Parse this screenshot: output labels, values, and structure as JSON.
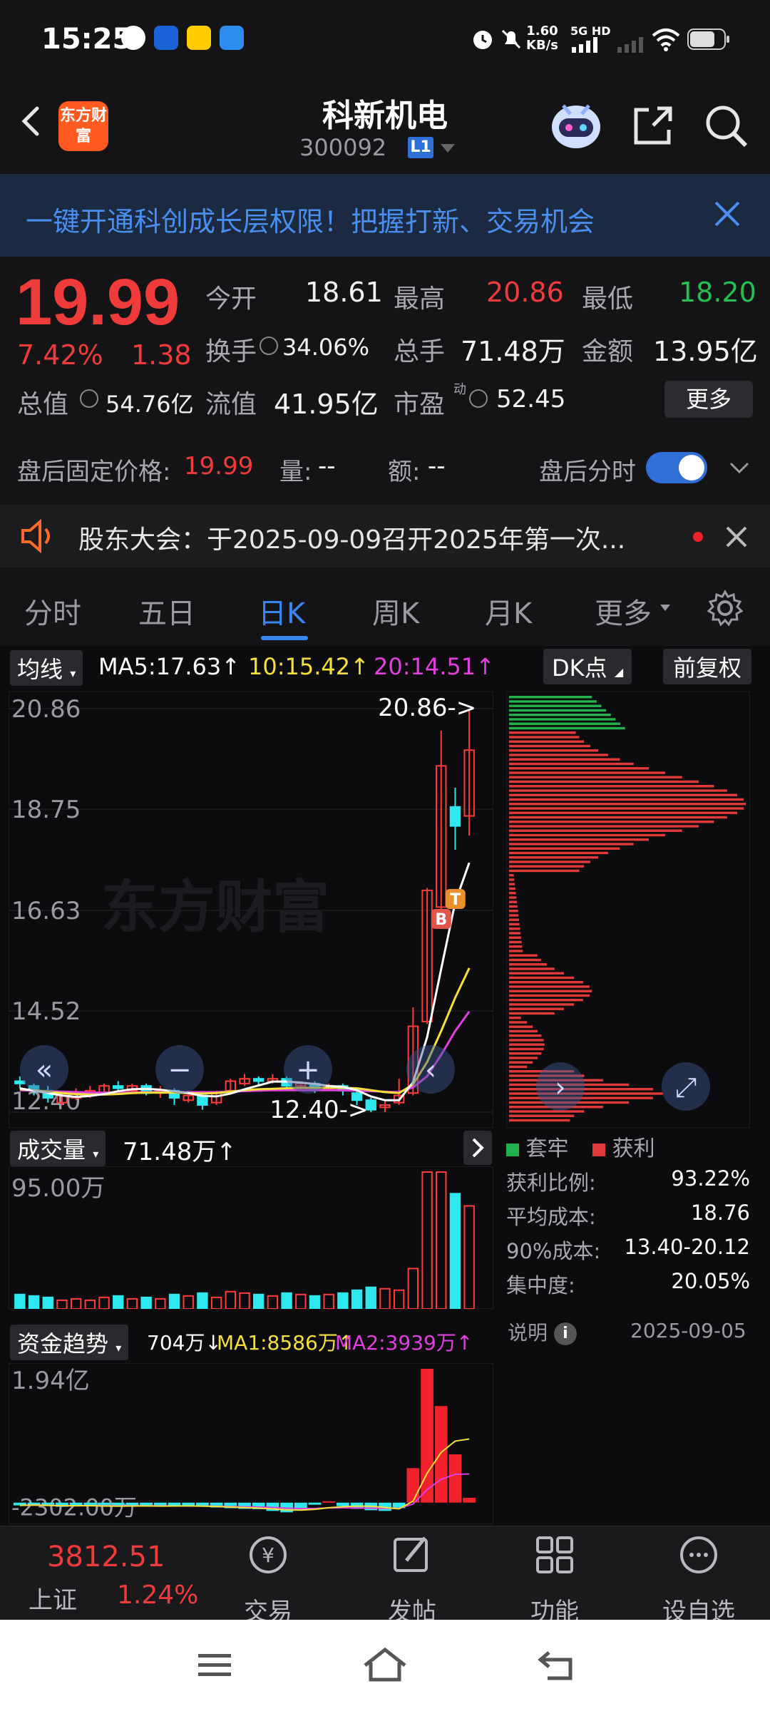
{
  "status": {
    "time": "15:25",
    "speed_value": "1.60",
    "speed_unit": "KB/s",
    "network": "5G HD"
  },
  "header": {
    "title": "科新机电",
    "code": "300092",
    "level": "L1",
    "logo_text": "东方财富"
  },
  "banner": {
    "text": "一键开通科创成长层权限！把握打新、交易机会"
  },
  "quote": {
    "price": "19.99",
    "change_pct": "7.42%",
    "change": "1.38",
    "open_label": "今开",
    "open": "18.61",
    "high_label": "最高",
    "high": "20.86",
    "low_label": "最低",
    "low": "18.20",
    "turnover_label": "换手",
    "turnover": "34.06%",
    "volume_label": "总手",
    "volume": "71.48万",
    "amount_label": "金额",
    "amount": "13.95亿",
    "mktcap_label": "总值",
    "mktcap": "54.76亿",
    "float_label": "流值",
    "float": "41.95亿",
    "pe_label": "市盈",
    "pe_sup": "动",
    "pe": "52.45",
    "more_label": "更多"
  },
  "after_hours": {
    "price_label": "盘后固定价格:",
    "price": "19.99",
    "vol_label": "量:",
    "vol": "--",
    "amt_label": "额:",
    "amt": "--",
    "switch_label": "盘后分时"
  },
  "notice": {
    "text": "股东大会：于2025-09-09召开2025年第一次..."
  },
  "tabs": [
    "分时",
    "五日",
    "日K",
    "周K",
    "月K",
    "更多"
  ],
  "chart_header": {
    "ma_pill": "均线",
    "ma5": "MA5:17.63",
    "ma10": "10:15.42",
    "ma20": "20:14.51",
    "up": "↑",
    "dk_pill": "DK点",
    "adj_pill": "前复权"
  },
  "chart_data": [
    {
      "type": "candlestick",
      "y_ticks": [
        "20.86",
        "18.75",
        "16.63",
        "14.52",
        "12.40"
      ],
      "ylim": [
        12.4,
        20.86
      ],
      "annotations": [
        "20.86->",
        "12.40->"
      ],
      "markers": [
        "B",
        "T"
      ],
      "watermark": "东方财富",
      "candles": [
        [
          13.05,
          13.0,
          13.15,
          12.9
        ],
        [
          12.95,
          12.85,
          13.0,
          12.75
        ],
        [
          12.85,
          12.7,
          12.95,
          12.6
        ],
        [
          12.6,
          12.75,
          12.8,
          12.55
        ],
        [
          12.7,
          12.8,
          12.9,
          12.65
        ],
        [
          12.75,
          12.85,
          12.95,
          12.7
        ],
        [
          12.8,
          12.95,
          13.0,
          12.75
        ],
        [
          12.95,
          12.9,
          13.05,
          12.8
        ],
        [
          12.85,
          12.95,
          13.0,
          12.8
        ],
        [
          12.95,
          12.8,
          13.0,
          12.75
        ],
        [
          12.8,
          12.85,
          12.95,
          12.7
        ],
        [
          12.85,
          12.7,
          12.9,
          12.55
        ],
        [
          12.65,
          12.75,
          12.85,
          12.6
        ],
        [
          12.75,
          12.55,
          12.8,
          12.45
        ],
        [
          12.6,
          12.8,
          12.85,
          12.55
        ],
        [
          12.85,
          13.05,
          13.1,
          12.8
        ],
        [
          13.0,
          13.1,
          13.2,
          12.95
        ],
        [
          13.1,
          13.05,
          13.15,
          12.95
        ],
        [
          13.05,
          13.1,
          13.2,
          13.0
        ],
        [
          13.1,
          12.95,
          13.15,
          12.9
        ],
        [
          12.95,
          13.0,
          13.05,
          12.85
        ],
        [
          13.0,
          12.9,
          13.05,
          12.8
        ],
        [
          12.9,
          12.95,
          13.0,
          12.85
        ],
        [
          12.95,
          12.85,
          13.0,
          12.75
        ],
        [
          12.8,
          12.65,
          12.85,
          12.55
        ],
        [
          12.65,
          12.45,
          12.7,
          12.4
        ],
        [
          12.5,
          12.55,
          12.65,
          12.4
        ],
        [
          12.6,
          12.75,
          13.1,
          12.55
        ],
        [
          12.8,
          14.2,
          14.6,
          12.75
        ],
        [
          14.3,
          17.05,
          17.1,
          14.25
        ],
        [
          16.7,
          19.66,
          20.4,
          16.5
        ],
        [
          18.8,
          18.4,
          19.2,
          17.9
        ],
        [
          18.61,
          19.99,
          20.86,
          18.2
        ]
      ],
      "ma5": [
        12.9,
        12.85,
        12.8,
        12.75,
        12.72,
        12.74,
        12.78,
        12.84,
        12.88,
        12.89,
        12.87,
        12.84,
        12.8,
        12.74,
        12.73,
        12.79,
        12.88,
        12.96,
        13.04,
        13.04,
        13.02,
        12.99,
        12.95,
        12.93,
        12.86,
        12.73,
        12.65,
        12.65,
        13.03,
        13.97,
        15.4,
        16.8,
        17.63
      ],
      "ma10": [
        12.88,
        12.86,
        12.83,
        12.8,
        12.78,
        12.77,
        12.77,
        12.78,
        12.8,
        12.81,
        12.81,
        12.81,
        12.8,
        12.79,
        12.8,
        12.83,
        12.86,
        12.88,
        12.89,
        12.9,
        12.91,
        12.91,
        12.91,
        12.91,
        12.9,
        12.86,
        12.82,
        12.8,
        12.98,
        13.45,
        14.1,
        14.8,
        15.42
      ],
      "ma20": [
        12.86,
        12.85,
        12.84,
        12.83,
        12.82,
        12.81,
        12.81,
        12.81,
        12.81,
        12.82,
        12.82,
        12.82,
        12.82,
        12.82,
        12.82,
        12.83,
        12.84,
        12.85,
        12.86,
        12.86,
        12.86,
        12.86,
        12.86,
        12.86,
        12.85,
        12.84,
        12.83,
        12.82,
        12.92,
        13.15,
        13.6,
        14.1,
        14.51
      ]
    },
    {
      "type": "bar",
      "title": "成交量",
      "value_label": "71.48万",
      "y_max_label": "95.00万",
      "values": [
        10,
        9,
        8,
        6,
        7,
        6,
        8,
        9,
        7,
        8,
        7,
        10,
        9,
        11,
        8,
        12,
        11,
        10,
        9,
        11,
        10,
        9,
        10,
        11,
        13,
        15,
        14,
        13,
        28,
        95,
        95,
        80,
        71.48
      ]
    },
    {
      "type": "bar",
      "title": "资金趋势",
      "value_label": "704万",
      "ma1": "MA1:8586万",
      "ma2": "MA2:3939万",
      "y_max_label": "1.94亿",
      "y_min_label": "-2302.00万",
      "values": [
        -400,
        -300,
        -500,
        -600,
        -450,
        -350,
        -550,
        -600,
        -500,
        -400,
        -450,
        -500,
        -550,
        -600,
        -700,
        -800,
        -900,
        -950,
        -1200,
        -1400,
        -1000,
        -300,
        200,
        -500,
        -900,
        -1100,
        -1200,
        -800,
        5000,
        19400,
        14000,
        7000,
        704
      ]
    }
  ],
  "chip": {
    "legend_trap": "套牢",
    "legend_profit": "获利",
    "rows": [
      {
        "label": "获利比例:",
        "value": "93.22%"
      },
      {
        "label": "平均成本:",
        "value": "18.76"
      },
      {
        "label": "90%成本:",
        "value": "13.40-20.12"
      },
      {
        "label": "集中度:",
        "value": "20.05%"
      }
    ],
    "explain": "说明",
    "date": "2025-09-05",
    "colors": {
      "trap": "#22b14c",
      "profit": "#e03a3a"
    }
  },
  "bottomnav": {
    "index_value": "3812.51",
    "index_name": "上证",
    "index_pct": "1.24%",
    "items": [
      "交易",
      "发帖",
      "功能",
      "设自选"
    ]
  }
}
